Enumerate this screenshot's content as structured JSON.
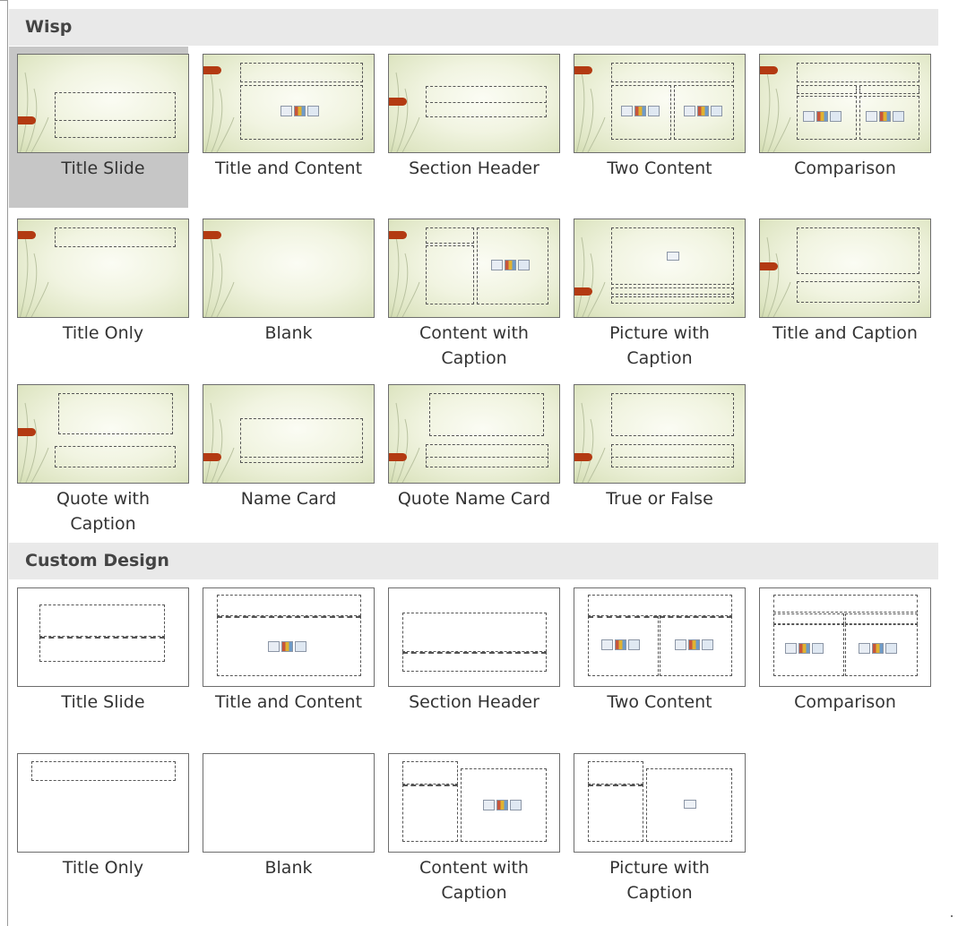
{
  "sections": [
    {
      "title": "Wisp",
      "layouts": [
        {
          "label": "Title Slide",
          "selected": true
        },
        {
          "label": "Title and Content"
        },
        {
          "label": "Section Header"
        },
        {
          "label": "Two Content"
        },
        {
          "label": "Comparison"
        },
        {
          "label": "Title Only"
        },
        {
          "label": "Blank"
        },
        {
          "label": "Content with\nCaption"
        },
        {
          "label": "Picture with\nCaption"
        },
        {
          "label": "Title and Caption"
        },
        {
          "label": "Quote with\nCaption"
        },
        {
          "label": "Name Card"
        },
        {
          "label": "Quote Name Card"
        },
        {
          "label": "True or False"
        }
      ]
    },
    {
      "title": "Custom Design",
      "layouts": [
        {
          "label": "Title Slide"
        },
        {
          "label": "Title and Content"
        },
        {
          "label": "Section Header"
        },
        {
          "label": "Two Content"
        },
        {
          "label": "Comparison"
        },
        {
          "label": "Title Only"
        },
        {
          "label": "Blank"
        },
        {
          "label": "Content with\nCaption"
        },
        {
          "label": "Picture with\nCaption"
        }
      ]
    }
  ],
  "colors": {
    "accent": "#b33a12",
    "selection": "#c6c6c6",
    "section_header_bg": "#e9e9e9"
  }
}
